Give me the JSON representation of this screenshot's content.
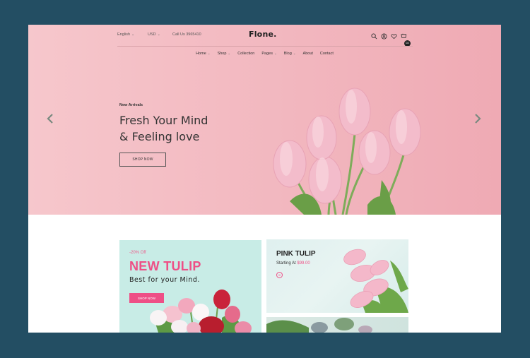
{
  "topbar": {
    "language": "English",
    "currency": "USD",
    "call": "Call Us 3965410",
    "logo": "Flone.",
    "cart_count": "02"
  },
  "nav": {
    "items": [
      {
        "label": "Home",
        "dropdown": true
      },
      {
        "label": "Shop",
        "dropdown": true
      },
      {
        "label": "Collection",
        "dropdown": false
      },
      {
        "label": "Pages",
        "dropdown": true
      },
      {
        "label": "Blog",
        "dropdown": true
      },
      {
        "label": "About",
        "dropdown": false
      },
      {
        "label": "Contact",
        "dropdown": false
      }
    ]
  },
  "hero": {
    "subtitle": "New Arrivals",
    "title_line1": "Fresh Your Mind",
    "title_line2": "& Feeling love",
    "button": "SHOP NOW"
  },
  "banner1": {
    "discount": "-20% Off",
    "title": "NEW TULIP",
    "subtitle": "Best for your Mind.",
    "button": "SHOP NOW"
  },
  "banner2": {
    "title": "PINK TULIP",
    "starting": "Starting At",
    "price": "$99.00"
  },
  "colors": {
    "accent": "#ee4f86",
    "background": "#234e63",
    "hero": "#f2b7bf",
    "mint": "#c8ece6"
  },
  "icons": [
    "search-icon",
    "user-icon",
    "heart-icon",
    "cart-icon",
    "chevron-left-icon",
    "chevron-right-icon"
  ]
}
